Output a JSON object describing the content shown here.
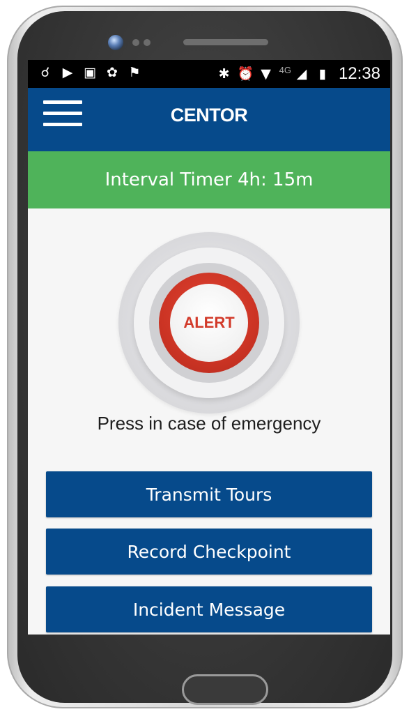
{
  "status_bar": {
    "left_icons": [
      "map-icon",
      "youtube-icon",
      "image-icon",
      "pinwheel-icon",
      "flag-icon"
    ],
    "right_icons": [
      "bluetooth-icon",
      "alarm-icon",
      "wifi-icon",
      "signal-icon",
      "battery-icon"
    ],
    "network": "4G",
    "time": "12:38"
  },
  "app_bar": {
    "title": "CENTOR"
  },
  "timer": {
    "text": "Interval Timer 4h: 15m"
  },
  "alert": {
    "label": "ALERT",
    "caption": "Press in case of emergency"
  },
  "actions": [
    {
      "label": "Transmit Tours"
    },
    {
      "label": "Record Checkpoint"
    },
    {
      "label": "Incident Message"
    }
  ],
  "colors": {
    "primary": "#064a8b",
    "timer_green": "#4fb35a",
    "alert_red": "#cc3424"
  }
}
